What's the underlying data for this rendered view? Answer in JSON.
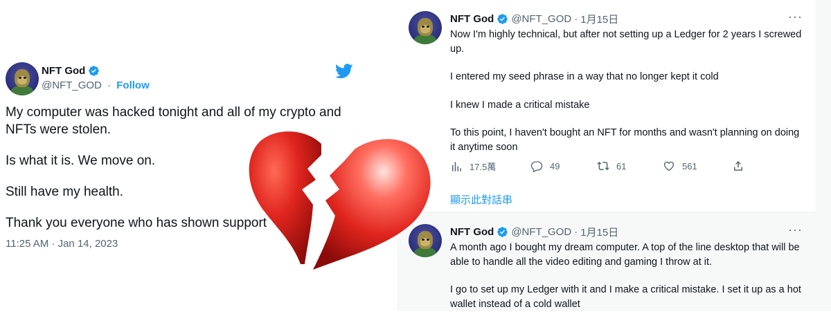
{
  "left_tweet": {
    "name": "NFT God",
    "handle": "@NFT_GOD",
    "separator": "·",
    "follow": "Follow",
    "paragraphs": [
      "My computer was hacked tonight and all of my crypto and NFTs were stolen.",
      "Is what it is. We move on.",
      "Still have my health.",
      "Thank you everyone who has shown support"
    ],
    "timestamp": "11:25 AM · Jan 14, 2023"
  },
  "thread": [
    {
      "name": "NFT God",
      "handle": "@NFT_GOD",
      "separator": "·",
      "date": "1月15日",
      "more": "···",
      "paragraphs": [
        "Now I'm highly technical, but after not setting up a Ledger for 2 years I screwed up.",
        "I entered my seed phrase in a way that no longer kept it cold",
        "I knew I made a critical mistake",
        "To this point, I haven't bought an NFT for months and wasn't planning on doing it anytime soon"
      ],
      "stats": {
        "views": "17.5萬",
        "replies": "49",
        "retweets": "61",
        "likes": "561"
      },
      "show_thread": "顯示此對話串"
    },
    {
      "name": "NFT God",
      "handle": "@NFT_GOD",
      "separator": "·",
      "date": "1月15日",
      "more": "···",
      "paragraphs": [
        "A month ago I bought my dream computer. A top of the line desktop that will be able to handle all the video editing and gaming  I throw at it.",
        "I go to set up my Ledger with it and I make a critical mistake. I set it up as a hot wallet instead of a cold wallet"
      ]
    }
  ],
  "icons": {
    "verified": "verified-badge-icon",
    "twitter": "twitter-bird-icon",
    "heart": "broken-heart-icon",
    "views": "views-icon",
    "reply": "reply-icon",
    "retweet": "retweet-icon",
    "like": "like-icon",
    "share": "share-icon"
  },
  "colors": {
    "brand": "#1d9bf0",
    "heart": "#e0251e",
    "secondary_text": "#536471"
  }
}
